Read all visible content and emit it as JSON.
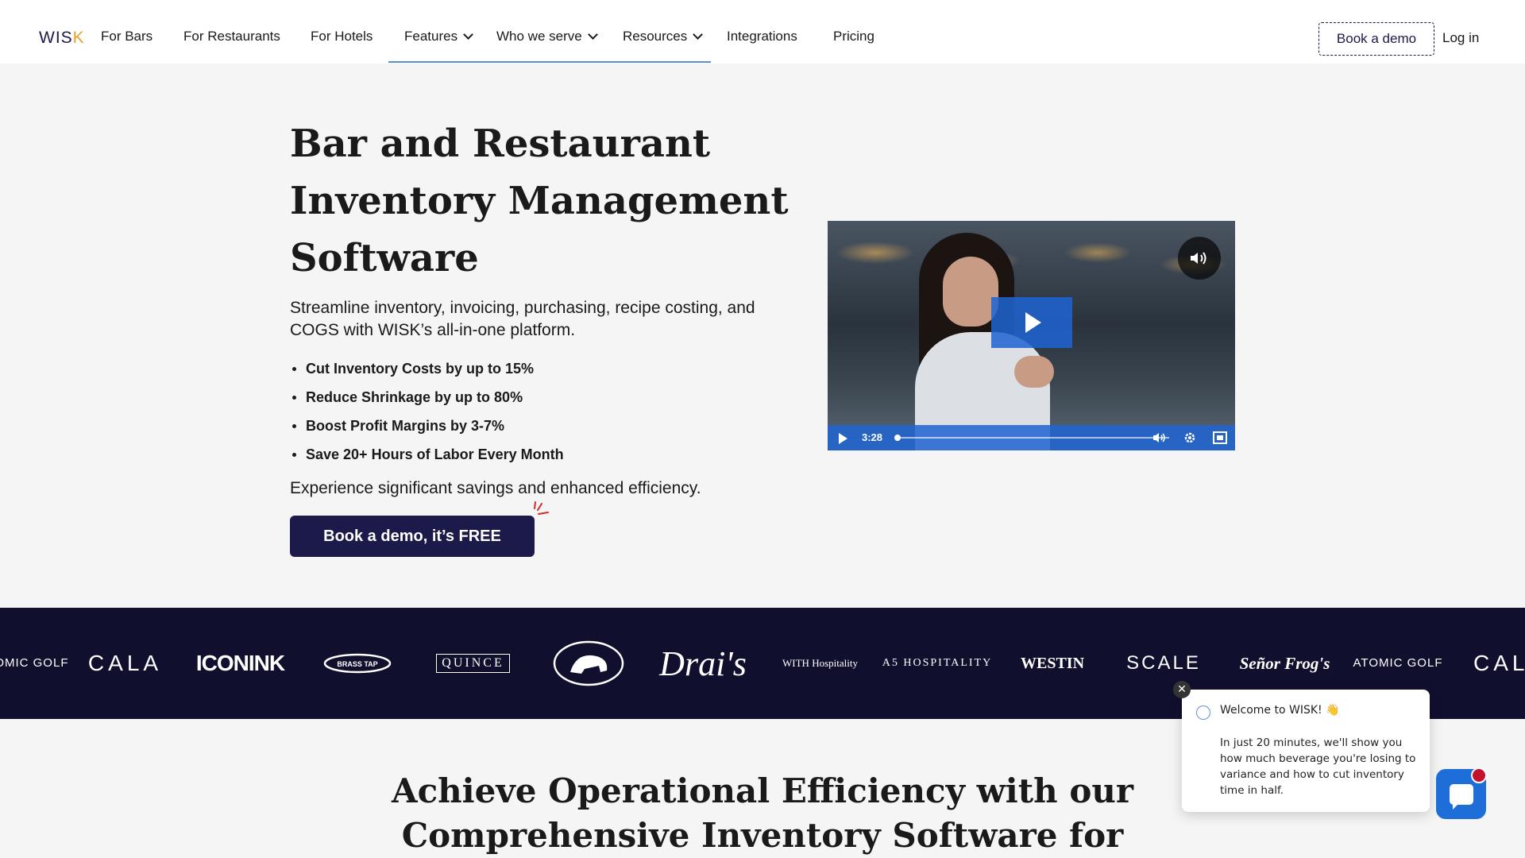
{
  "nav": {
    "logo_prefix": "WIS",
    "logo_suffix": "K",
    "items": [
      {
        "label": "For Bars"
      },
      {
        "label": "For Restaurants"
      },
      {
        "label": "For Hotels"
      },
      {
        "label": "Features"
      },
      {
        "label": "Who we serve"
      },
      {
        "label": "Resources"
      },
      {
        "label": "Integrations"
      },
      {
        "label": "Pricing"
      }
    ],
    "book_demo": "Book a demo",
    "login": "Log in"
  },
  "hero": {
    "title": "Bar and Restaurant Inventory Management Software",
    "subtitle": "Streamline inventory, invoicing, purchasing, recipe costing, and COGS with WISK’s all-in-one platform.",
    "bullets": [
      "Cut Inventory Costs by up to 15%",
      "Reduce Shrinkage by up to 80%",
      "Boost Profit Margins by 3-7%",
      "Save 20+ Hours of Labor Every Month"
    ],
    "note": "Experience significant savings and enhanced efficiency.",
    "cta": "Book a demo, it’s FREE"
  },
  "video": {
    "duration": "3:28",
    "progress": 0.0,
    "accent": "#1e64d2"
  },
  "logos": [
    "ATOMIC GOLF",
    "CALA",
    "ICONINK",
    "BRASS TAP",
    "QUINCE",
    "BEAR",
    "Drai's",
    "WITH Hospitality",
    "A5 HOSPITALITY",
    "WESTIN",
    "SCALE",
    "Señor Frog's",
    "ATOMIC GOLF",
    "CAL"
  ],
  "section": {
    "title": "Achieve Operational Efficiency with our Comprehensive Inventory Software for"
  },
  "chat": {
    "welcome": "Welcome to WISK! 👋",
    "body": "In just 20 minutes, we'll show you how much beverage you're losing to variance and how to cut inventory time in half.",
    "close": "✕"
  },
  "colors": {
    "brand_navy": "#1c1a4a",
    "strip_bg": "#110f2e",
    "chat_blue": "#1d6ed8",
    "logo_accent": "#e4a329"
  }
}
